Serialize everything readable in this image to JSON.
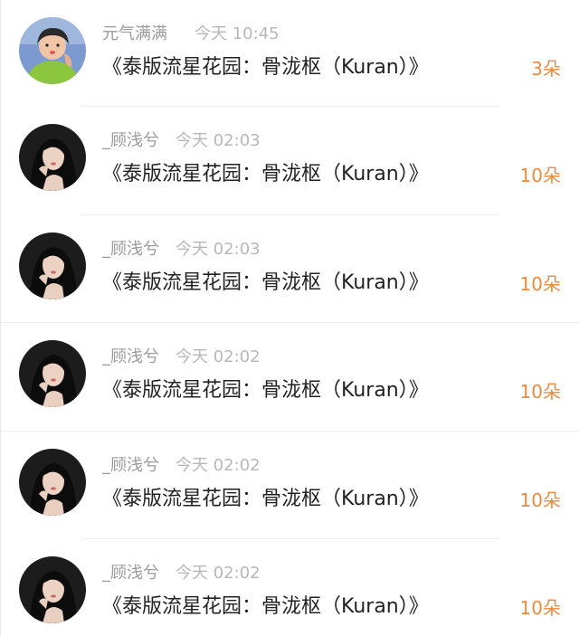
{
  "colors": {
    "username": "#9a9a9a",
    "time": "#b8b8b8",
    "title": "#222222",
    "count": "#ec8a40"
  },
  "gifts": [
    {
      "username": "元气满满",
      "time": "今天 10:45",
      "title": "《泰版流星花园：骨泷枢（Kuran）》",
      "count": "3朵",
      "avatar_icon": "avatar-girl-green-hoodie"
    },
    {
      "username": "_顾浅兮",
      "time": "今天 02:03",
      "title": "《泰版流星花园：骨泷枢（Kuran）》",
      "count": "10朵",
      "avatar_icon": "avatar-woman-dark-hair"
    },
    {
      "username": "_顾浅兮",
      "time": "今天 02:03",
      "title": "《泰版流星花园：骨泷枢（Kuran）》",
      "count": "10朵",
      "avatar_icon": "avatar-woman-dark-hair"
    },
    {
      "username": "_顾浅兮",
      "time": "今天 02:02",
      "title": "《泰版流星花园：骨泷枢（Kuran）》",
      "count": "10朵",
      "avatar_icon": "avatar-woman-dark-hair"
    },
    {
      "username": "_顾浅兮",
      "time": "今天 02:02",
      "title": "《泰版流星花园：骨泷枢（Kuran）》",
      "count": "10朵",
      "avatar_icon": "avatar-woman-dark-hair"
    },
    {
      "username": "_顾浅兮",
      "time": "今天 02:02",
      "title": "《泰版流星花园：骨泷枢（Kuran）》",
      "count": "10朵",
      "avatar_icon": "avatar-woman-dark-hair"
    }
  ]
}
